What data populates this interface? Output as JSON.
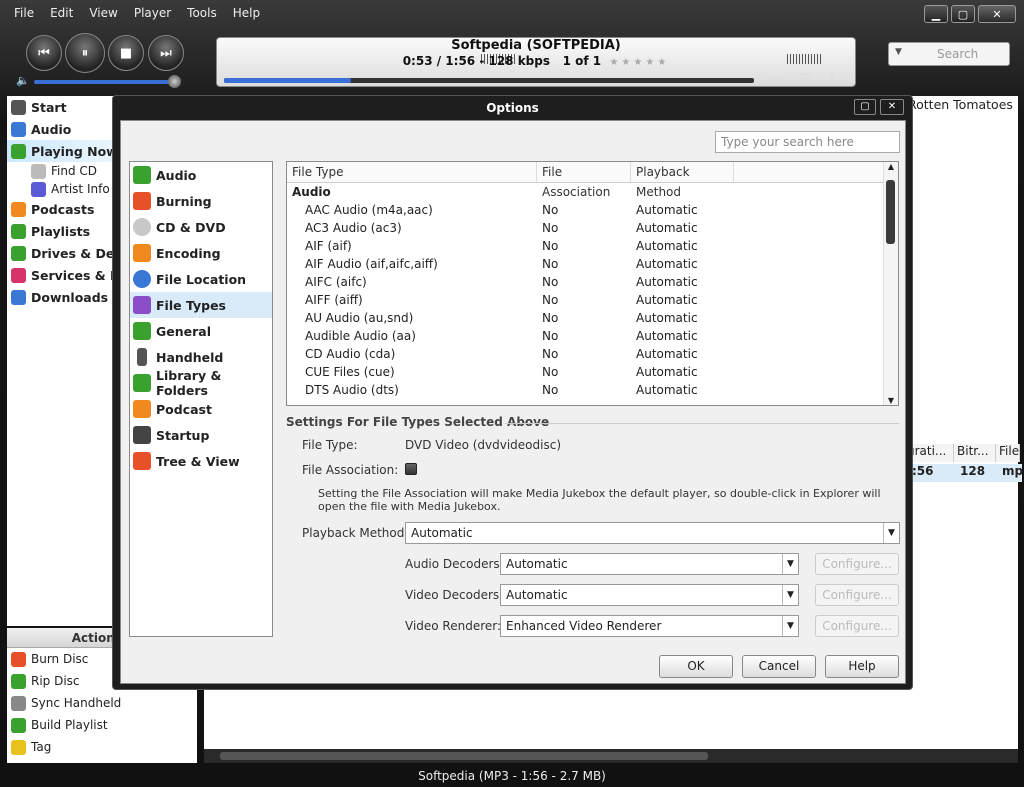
{
  "menu": [
    "File",
    "Edit",
    "View",
    "Player",
    "Tools",
    "Help"
  ],
  "window_buttons": {
    "minimize": "▁",
    "maximize": "▢",
    "close": "✕"
  },
  "player": {
    "title": "Softpedia (SOFTPEDIA)",
    "time": "0:53 / 1:56 - 128 kbps",
    "position": "1 of 1",
    "stars": "★★★★★",
    "progress": 0.24,
    "volume": 1.0
  },
  "search": {
    "placeholder": "Search"
  },
  "sidebar": {
    "items": [
      {
        "label": "Start",
        "color": "#555"
      },
      {
        "label": "Audio",
        "color": "#3a78d6"
      },
      {
        "label": "Playing Now",
        "color": "#3aa12e"
      },
      {
        "label": "Find CD",
        "color": "#888"
      },
      {
        "label": "Artist Info",
        "color": "#5a5ad6"
      },
      {
        "label": "Podcasts",
        "color": "#f08a1e"
      },
      {
        "label": "Playlists",
        "color": "#3aa12e"
      },
      {
        "label": "Drives & Dev",
        "color": "#3aa12e"
      },
      {
        "label": "Services & Pl",
        "color": "#d6336a"
      },
      {
        "label": "Downloads",
        "color": "#3a78d6"
      }
    ]
  },
  "action": {
    "header": "Action W",
    "items": [
      "Burn Disc",
      "Rip Disc",
      "Sync Handheld",
      "Build Playlist",
      "Tag"
    ]
  },
  "right_pane": {
    "tomatoes": "Rotten Tomatoes",
    "headers": [
      "urati...",
      "Bitr...",
      "File"
    ],
    "row": [
      ":56",
      "128",
      "mp"
    ]
  },
  "status": "Softpedia (MP3 - 1:56 - 2.7 MB)",
  "dialog": {
    "title": "Options",
    "search_placeholder": "Type your search here",
    "tree": [
      {
        "label": "Audio",
        "color": "#3aa12e"
      },
      {
        "label": "Burning",
        "color": "#e8502a"
      },
      {
        "label": "CD & DVD",
        "color": "#c8c8c8"
      },
      {
        "label": "Encoding",
        "color": "#f08a1e"
      },
      {
        "label": "File Location",
        "color": "#3a78d6"
      },
      {
        "label": "File Types",
        "color": "#8a4fc8"
      },
      {
        "label": "General",
        "color": "#3aa12e"
      },
      {
        "label": "Handheld",
        "color": "#555"
      },
      {
        "label": "Library & Folders",
        "color": "#3aa12e"
      },
      {
        "label": "Podcast",
        "color": "#f08a1e"
      },
      {
        "label": "Startup",
        "color": "#444"
      },
      {
        "label": "Tree & View",
        "color": "#e8502a"
      }
    ],
    "table": {
      "headers": [
        "File Type",
        "File Association",
        "Playback Method"
      ],
      "group": "Audio",
      "rows": [
        [
          "AAC Audio (m4a,aac)",
          "No",
          "Automatic"
        ],
        [
          "AC3 Audio (ac3)",
          "No",
          "Automatic"
        ],
        [
          "AIF (aif)",
          "No",
          "Automatic"
        ],
        [
          "AIF Audio (aif,aifc,aiff)",
          "No",
          "Automatic"
        ],
        [
          "AIFC (aifc)",
          "No",
          "Automatic"
        ],
        [
          "AIFF (aiff)",
          "No",
          "Automatic"
        ],
        [
          "AU Audio (au,snd)",
          "No",
          "Automatic"
        ],
        [
          "Audible Audio (aa)",
          "No",
          "Automatic"
        ],
        [
          "CD Audio (cda)",
          "No",
          "Automatic"
        ],
        [
          "CUE Files (cue)",
          "No",
          "Automatic"
        ],
        [
          "DTS Audio (dts)",
          "No",
          "Automatic"
        ]
      ]
    },
    "settings": {
      "heading": "Settings For File Types Selected Above",
      "file_type_label": "File Type:",
      "file_type_value": "DVD Video (dvdvideodisc)",
      "assoc_label": "File Association:",
      "assoc_note": "Setting the File Association will make Media Jukebox the default player, so double-click in Explorer will open the file with Media Jukebox.",
      "playback_label": "Playback Method:",
      "playback_value": "Automatic",
      "audio_dec_label": "Audio Decoders:",
      "audio_dec_value": "Automatic",
      "video_dec_label": "Video Decoders:",
      "video_dec_value": "Automatic",
      "renderer_label": "Video Renderer:",
      "renderer_value": "Enhanced Video Renderer",
      "configure": "Configure..."
    },
    "buttons": {
      "ok": "OK",
      "cancel": "Cancel",
      "help": "Help"
    }
  }
}
